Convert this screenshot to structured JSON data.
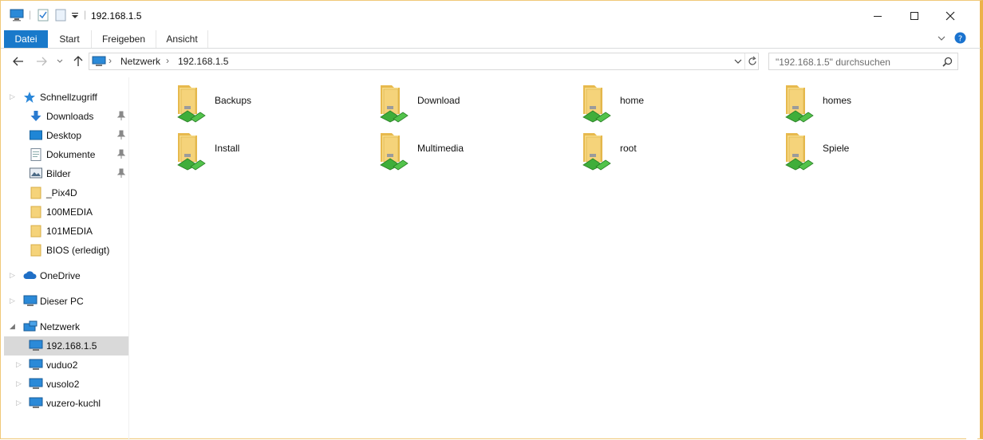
{
  "window": {
    "title": "192.168.1.5",
    "controls": {
      "minimize": "—",
      "maximize": "☐",
      "close": "✕"
    }
  },
  "ribbon": {
    "tabs": [
      {
        "label": "Datei"
      },
      {
        "label": "Start"
      },
      {
        "label": "Freigeben"
      },
      {
        "label": "Ansicht"
      }
    ]
  },
  "address": {
    "segments": [
      "Netzwerk",
      "192.168.1.5"
    ],
    "search_placeholder": "\"192.168.1.5\" durchsuchen"
  },
  "nav": {
    "quick_access": "Schnellzugriff",
    "pinned": [
      "Downloads",
      "Desktop",
      "Dokumente",
      "Bilder"
    ],
    "folders": [
      "_Pix4D",
      "100MEDIA",
      "101MEDIA",
      "BIOS (erledigt)"
    ],
    "onedrive": "OneDrive",
    "this_pc": "Dieser PC",
    "network": "Netzwerk",
    "network_items": [
      "192.168.1.5",
      "vuduo2",
      "vusolo2",
      "vuzero-kuchl"
    ]
  },
  "content": {
    "shares": [
      "Backups",
      "Download",
      "home",
      "homes",
      "Install",
      "Multimedia",
      "root",
      "Spiele"
    ]
  },
  "colors": {
    "file_tab": "#1979ca",
    "selection": "#d9d9d9",
    "window_border": "#ecb24a",
    "folder": "#f5d37a",
    "share_green": "#3fae3a"
  }
}
